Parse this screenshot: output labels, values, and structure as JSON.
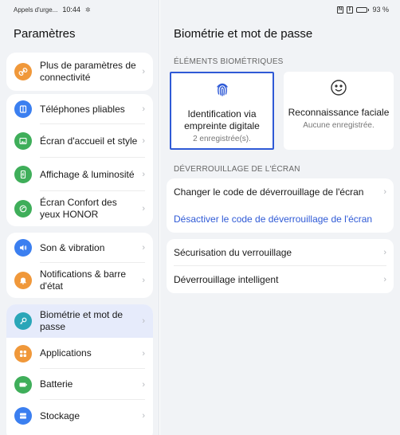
{
  "status_left": {
    "notification": "Appels d'urge...",
    "time": "10:44"
  },
  "status_right": {
    "battery": "93 %",
    "battery_level": 0.93
  },
  "left": {
    "title": "Paramètres",
    "groups": [
      {
        "items": [
          {
            "label": "Plus de paramètres de connectivité",
            "icon": "link-icon",
            "color": "#f0983a"
          }
        ]
      },
      {
        "items": [
          {
            "label": "Téléphones pliables",
            "icon": "foldable-icon",
            "color": "#3b7ff0"
          },
          {
            "label": "Écran d'accueil et style",
            "icon": "image-icon",
            "color": "#3fae5a"
          },
          {
            "label": "Affichage & luminosité",
            "icon": "display-icon",
            "color": "#3fae5a"
          },
          {
            "label": "Écran Confort des yeux HONOR",
            "icon": "eye-comfort-icon",
            "color": "#3fae5a"
          }
        ]
      },
      {
        "items": [
          {
            "label": "Son & vibration",
            "icon": "speaker-icon",
            "color": "#3b7ff0"
          },
          {
            "label": "Notifications & barre d'état",
            "icon": "bell-icon",
            "color": "#f0983a"
          }
        ]
      },
      {
        "items": [
          {
            "label": "Biométrie et mot de passe",
            "icon": "key-icon",
            "color": "#2aa6b8",
            "active": true
          },
          {
            "label": "Applications",
            "icon": "apps-icon",
            "color": "#f0983a"
          },
          {
            "label": "Batterie",
            "icon": "battery-icon",
            "color": "#3fae5a"
          },
          {
            "label": "Stockage",
            "icon": "storage-icon",
            "color": "#3b7ff0"
          }
        ]
      }
    ]
  },
  "right": {
    "title": "Biométrie et mot de passe",
    "biometric_section": "ÉLÉMENTS BIOMÉTRIQUES",
    "fingerprint": {
      "name": "Identification via empreinte digitale",
      "sub": "2 enregistrée(s)."
    },
    "face": {
      "name": "Reconnaissance faciale",
      "sub": "Aucune enregistrée."
    },
    "unlock_section": "DÉVERROUILLAGE DE L'ÉCRAN",
    "unlock": {
      "change": "Changer le code de déverrouillage de l'écran",
      "disable": "Désactiver le code de déverrouillage de l'écran"
    },
    "lock_security": "Sécurisation du verrouillage",
    "smart_unlock": "Déverrouillage intelligent"
  },
  "colors": {
    "accent": "#2f5ad6",
    "active_row": "#e6ebfb"
  }
}
